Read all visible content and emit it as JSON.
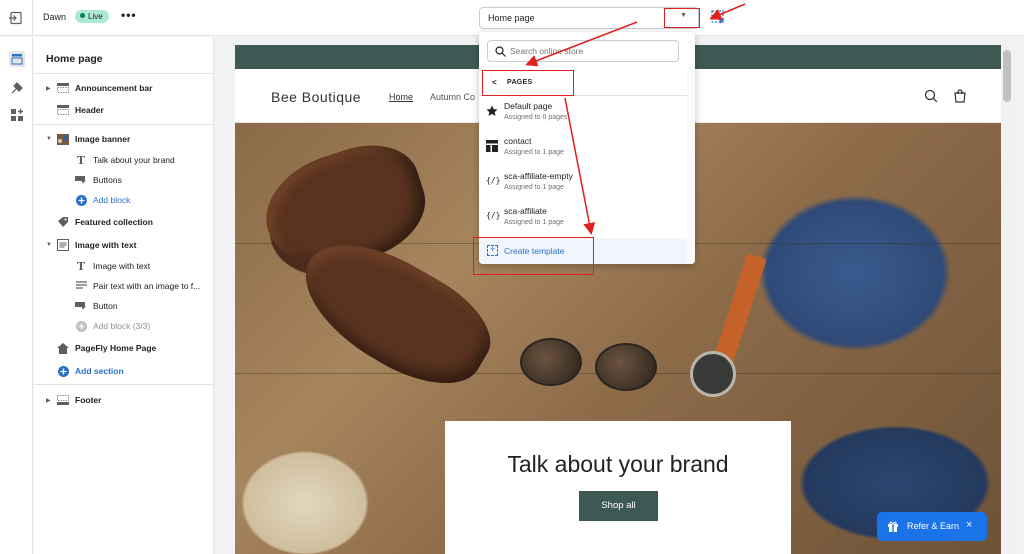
{
  "topbar": {
    "theme_name": "Dawn",
    "status": "Live",
    "more": "•••",
    "page_select": "Home page"
  },
  "sidebar": {
    "title": "Home page",
    "items": [
      {
        "label": "Announcement bar"
      },
      {
        "label": "Header"
      },
      {
        "label": "Image banner"
      },
      {
        "label": "Talk about your brand"
      },
      {
        "label": "Buttons"
      },
      {
        "label": "Add block"
      },
      {
        "label": "Featured collection"
      },
      {
        "label": "Image with text"
      },
      {
        "label": "Image with text"
      },
      {
        "label": "Pair text with an image to f..."
      },
      {
        "label": "Button"
      },
      {
        "label": "Add block (3/3)"
      },
      {
        "label": "PageFly Home Page"
      },
      {
        "label": "Add section"
      },
      {
        "label": "Footer"
      }
    ]
  },
  "dropdown": {
    "search_placeholder": "Search online store",
    "section_label": "PAGES",
    "items": [
      {
        "name": "Default page",
        "sub": "Assigned to 0 pages",
        "icon": "star-icon"
      },
      {
        "name": "contact",
        "sub": "Assigned to 1 page",
        "icon": "layout-icon"
      },
      {
        "name": "sca-affiliate-empty",
        "sub": "Assigned to 1 page",
        "icon": "liquid-code-icon"
      },
      {
        "name": "sca-affiliate",
        "sub": "Assigned to 1 page",
        "icon": "liquid-code-icon"
      }
    ],
    "create_label": "Create template"
  },
  "preview": {
    "store_name": "Bee Boutique",
    "nav": [
      "Home",
      "Autumn Co"
    ],
    "banner_heading": "Talk about your brand",
    "banner_button": "Shop all"
  },
  "refer": {
    "label": "Refer & Earn",
    "close": "×"
  },
  "colors": {
    "accent": "#2c6ecb",
    "annotation": "#e01f1f",
    "brand_dark": "#3e5854",
    "live_badge": "#aee9d1",
    "refer_button": "#1a73e8"
  }
}
